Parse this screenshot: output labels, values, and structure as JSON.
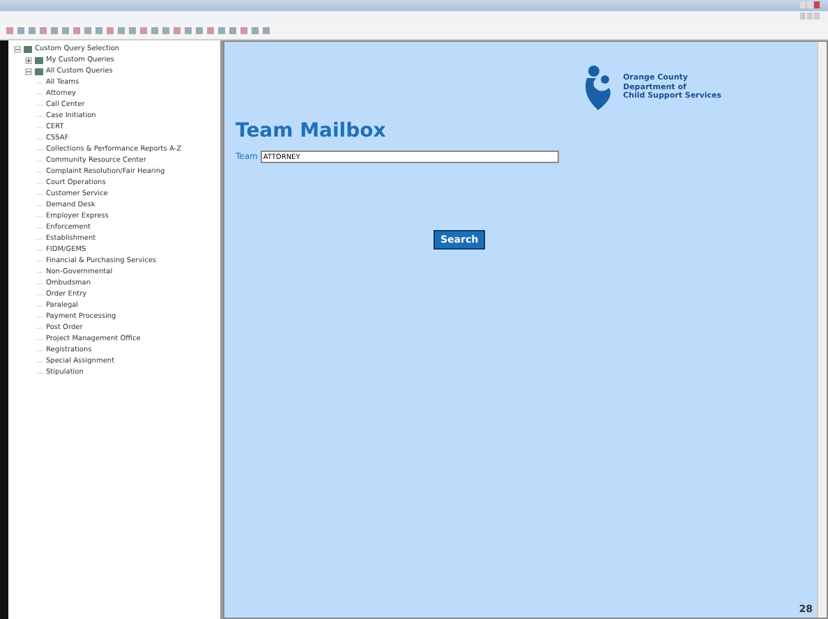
{
  "tree": [
    {
      "label": "Custom Query Selection",
      "kind": "folder",
      "expanded": true,
      "children": [
        {
          "label": "My Custom Queries",
          "kind": "folder",
          "expanded": false
        },
        {
          "label": "All Custom Queries",
          "kind": "folder",
          "expanded": true,
          "children": [
            {
              "label": "All Teams"
            },
            {
              "label": "Attorney"
            },
            {
              "label": "Call Center"
            },
            {
              "label": "Case Initiation"
            },
            {
              "label": "CERT"
            },
            {
              "label": "CSSAF"
            },
            {
              "label": "Collections & Performance Reports A-Z"
            },
            {
              "label": "Community Resource Center"
            },
            {
              "label": "Complaint Resolution/Fair Hearing"
            },
            {
              "label": "Court Operations"
            },
            {
              "label": "Customer Service"
            },
            {
              "label": "Demand Desk"
            },
            {
              "label": "Employer Express"
            },
            {
              "label": "Enforcement"
            },
            {
              "label": "Establishment"
            },
            {
              "label": "FIDM/GEMS"
            },
            {
              "label": "Financial & Purchasing Services"
            },
            {
              "label": "Non-Governmental"
            },
            {
              "label": "Ombudsman"
            },
            {
              "label": "Order Entry"
            },
            {
              "label": "Paralegal"
            },
            {
              "label": "Payment Processing"
            },
            {
              "label": "Post Order"
            },
            {
              "label": "Project Management Office"
            },
            {
              "label": "Registrations"
            },
            {
              "label": "Special Assignment"
            },
            {
              "label": "Stipulation"
            }
          ]
        }
      ]
    }
  ],
  "logo": {
    "lines": [
      "Orange County",
      "Department of",
      "Child Support Services"
    ]
  },
  "heading": "Team Mailbox",
  "team_field": {
    "label": "Team",
    "value": "ATTORNEY"
  },
  "search_button": "Search",
  "page_number": "28"
}
